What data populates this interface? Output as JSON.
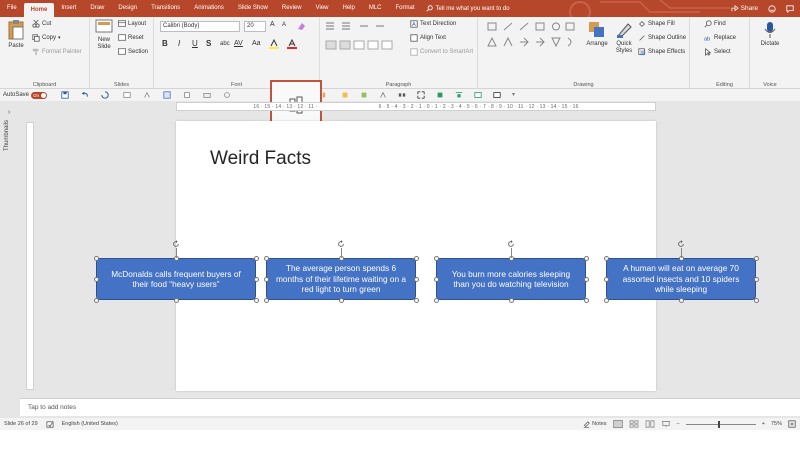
{
  "tabs": [
    "File",
    "Home",
    "Insert",
    "Draw",
    "Design",
    "Transitions",
    "Animations",
    "Slide Show",
    "Review",
    "View",
    "Help",
    "MLC",
    "Format"
  ],
  "active_tab": "Home",
  "tell_me": "Tell me what you want to do",
  "share": "Share",
  "clipboard": {
    "paste": "Paste",
    "cut": "Cut",
    "copy": "Copy",
    "format_painter": "Format Painter",
    "label": "Clipboard"
  },
  "slides": {
    "new_slide": "New Slide",
    "layout": "Layout",
    "reset": "Reset",
    "section": "Section",
    "label": "Slides"
  },
  "font": {
    "name": "Calibri (Body)",
    "size": "20",
    "label": "Font",
    "bold": "B",
    "italic": "I",
    "underline": "U",
    "strike": "S",
    "shadow": "abc",
    "spacing": "AV",
    "case": "Aa"
  },
  "paragraph": {
    "text_direction": "Text Direction",
    "align_text": "Align Text",
    "smartart": "Convert to SmartArt",
    "label": "Paragraph"
  },
  "drawing": {
    "arrange": "Arrange",
    "quick_styles": "Quick Styles",
    "shape_fill": "Shape Fill",
    "shape_outline": "Shape Outline",
    "shape_effects": "Shape Effects",
    "label": "Drawing"
  },
  "editing": {
    "find": "Find",
    "replace": "Replace",
    "select": "Select",
    "label": "Editing"
  },
  "voice": {
    "dictate": "Dictate",
    "label": "Voice"
  },
  "autosave": {
    "label": "AutoSave",
    "state": "On"
  },
  "ruler_text": "16 · 15 · 14 · 13 · 12 · 11 · 10 · 9 · 8 · 7 · 6 · 5 · 4 · 3 · 2 · 1 · 0 · 1 · 2 · 3 · 4 · 5 · 6 · 7 · 8 · 9 · 10 · 11 · 12 · 13 · 14 · 15 · 16",
  "ruler_left": "16 · 15 · 14 · 13 · 12 · 11 ·",
  "ruler_right": "6 · 5 · 4 · 3 · 2 · 1 · 0 · 1 · 2 · 3 · 4 · 5 · 6 · 7 · 8 · 9 · 10 · 11 · 12 · 13 · 14 · 15 · 16",
  "thumbnails_label": "Thumbnails",
  "slide": {
    "title": "Weird Facts",
    "boxes": [
      "McDonalds calls frequent buyers of their food “heavy users”",
      "The average person spends 6 months of their lifetime waiting on a red light to turn green",
      "You burn more calories sleeping than you do watching television",
      "A human will eat on average 70 assorted insects and 10 spiders while sleeping"
    ]
  },
  "notes_placeholder": "Tap to add notes",
  "status": {
    "slide_info": "Slide 26 of 29",
    "language": "English (United States)",
    "notes": "Notes",
    "zoom": "75%"
  },
  "colors": {
    "accent": "#b7472a",
    "shape_fill": "#4472c4",
    "shape_border": "#2f528f"
  }
}
